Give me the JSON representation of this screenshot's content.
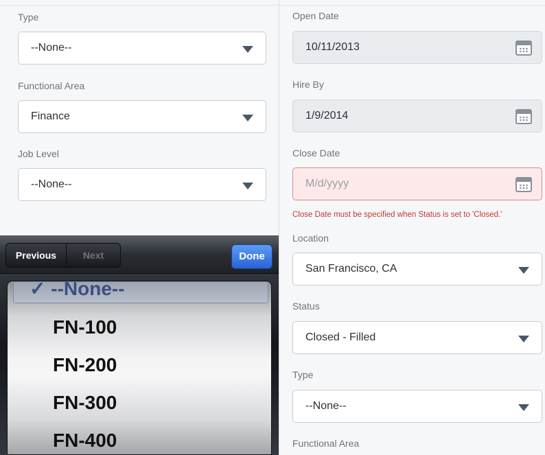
{
  "left": {
    "fields": [
      {
        "label": "Type",
        "value": "--None--"
      },
      {
        "label": "Functional Area",
        "value": "Finance"
      },
      {
        "label": "Job Level",
        "value": "--None--"
      }
    ]
  },
  "keyboard": {
    "prev_label": "Previous",
    "next_label": "Next",
    "done_label": "Done",
    "options": [
      {
        "label": "--None--",
        "check": "✓",
        "selected": true
      },
      {
        "label": "FN-100"
      },
      {
        "label": "FN-200"
      },
      {
        "label": "FN-300"
      },
      {
        "label": "FN-400"
      }
    ]
  },
  "right": {
    "open_date": {
      "label": "Open Date",
      "value": "10/11/2013"
    },
    "hire_by": {
      "label": "Hire By",
      "value": "1/9/2014"
    },
    "close_date": {
      "label": "Close Date",
      "placeholder": "M/d/yyyy",
      "error": "Close Date must be specified when Status is set to 'Closed.'"
    },
    "location": {
      "label": "Location",
      "value": "San Francisco, CA"
    },
    "status": {
      "label": "Status",
      "value": "Closed - Filled"
    },
    "type": {
      "label": "Type",
      "value": "--None--"
    },
    "functional_area": {
      "label": "Functional Area"
    }
  },
  "colors": {
    "error": "#c23934",
    "done_button": "#2f6fe0",
    "caret": "#4a5866"
  }
}
